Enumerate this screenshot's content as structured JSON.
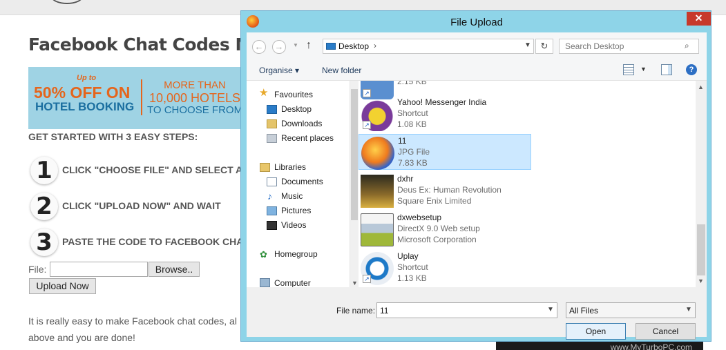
{
  "webpage": {
    "title": "Facebook Chat Codes Ma",
    "banner": {
      "upto": "Up to",
      "off": "50% OFF ON",
      "hotel_booking": "HOTEL BOOKING",
      "more_than": "MORE THAN",
      "hotels": "10,000 HOTELS",
      "choose": "TO CHOOSE FROM"
    },
    "steps_heading": "GET STARTED WITH 3 EASY STEPS:",
    "steps": [
      {
        "num": "1",
        "text": "CLICK \"CHOOSE FILE\" AND SELECT AN"
      },
      {
        "num": "2",
        "text": "CLICK \"UPLOAD NOW\" AND WAIT"
      },
      {
        "num": "3",
        "text": "PASTE THE CODE TO FACEBOOK CHA"
      }
    ],
    "file_label": "File:",
    "browse_label": "Browse..",
    "upload_label": "Upload Now",
    "paragraph_line1": "It is really easy to make Facebook chat codes, al",
    "paragraph_line2": "above and you are done!",
    "watermark": "www.MyTurboPC.com"
  },
  "dialog": {
    "title": "File Upload",
    "close": "✕",
    "address": {
      "back": "←",
      "forward": "→",
      "up": "↑",
      "location": "Desktop",
      "refresh": "↻"
    },
    "search_placeholder": "Search Desktop",
    "toolbar": {
      "organise": "Organise ▾",
      "new_folder": "New folder",
      "help": "?"
    },
    "nav_items": [
      {
        "label": "Favourites",
        "icon": "star-icon"
      },
      {
        "label": "Desktop",
        "icon": "desktop-icon"
      },
      {
        "label": "Downloads",
        "icon": "downloads-icon"
      },
      {
        "label": "Recent places",
        "icon": "recent-places-icon"
      },
      {
        "label": "Libraries",
        "icon": "libraries-icon"
      },
      {
        "label": "Documents",
        "icon": "documents-icon"
      },
      {
        "label": "Music",
        "icon": "music-icon"
      },
      {
        "label": "Pictures",
        "icon": "pictures-icon"
      },
      {
        "label": "Videos",
        "icon": "videos-icon"
      },
      {
        "label": "Homegroup",
        "icon": "homegroup-icon"
      },
      {
        "label": "Computer",
        "icon": "computer-icon"
      }
    ],
    "files": [
      {
        "name": "",
        "line2": "2.15 KB",
        "line3": "",
        "icon": "shortcut-icon"
      },
      {
        "name": "Yahoo! Messenger India",
        "line2": "Shortcut",
        "line3": "1.08 KB",
        "icon": "yahoo-messenger-icon"
      },
      {
        "name": "11",
        "line2": "JPG File",
        "line3": "7.83 KB",
        "icon": "firefox-icon",
        "selected": true
      },
      {
        "name": "dxhr",
        "line2": "Deus Ex: Human Revolution",
        "line3": "Square Enix Limited",
        "icon": "deus-ex-icon"
      },
      {
        "name": "dxwebsetup",
        "line2": "DirectX 9.0 Web setup",
        "line3": "Microsoft Corporation",
        "icon": "installer-icon"
      },
      {
        "name": "Uplay",
        "line2": "Shortcut",
        "line3": "1.13 KB",
        "icon": "uplay-icon"
      }
    ],
    "filename_label": "File name:",
    "filename_value": "11",
    "filter_value": "All Files",
    "open_label": "Open",
    "cancel_label": "Cancel"
  }
}
